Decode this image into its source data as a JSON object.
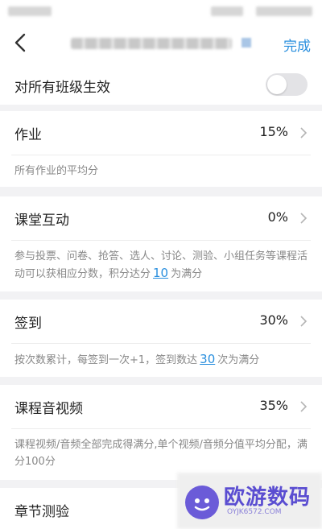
{
  "nav": {
    "done_label": "完成"
  },
  "toggle_row": {
    "label": "对所有班级生效",
    "enabled": false
  },
  "sections": [
    {
      "label": "作业",
      "value": "15%",
      "desc": "所有作业的平均分"
    },
    {
      "label": "课堂互动",
      "value": "0%",
      "desc_prefix": "参与投票、问卷、抢答、选人、讨论、测验、小组任务等课程活动可以获相应分数，积分达分",
      "desc_num": "10",
      "desc_suffix": "为满分"
    },
    {
      "label": "签到",
      "value": "30%",
      "desc_prefix": "按次数累计，每签到一次+1，签到数达",
      "desc_num": "30",
      "desc_suffix": "次为满分"
    },
    {
      "label": "课程音视频",
      "value": "35%",
      "desc": "课程视频/音频全部完成得满分,单个视频/音频分值平均分配，满分100分"
    },
    {
      "label": "章节测验"
    }
  ],
  "watermark": {
    "text": "欧游数码",
    "sub": "OYJK6572.COM"
  },
  "colors": {
    "accent": "#2a8fde",
    "background": "#f2f2f4",
    "desc_text": "#888888"
  }
}
